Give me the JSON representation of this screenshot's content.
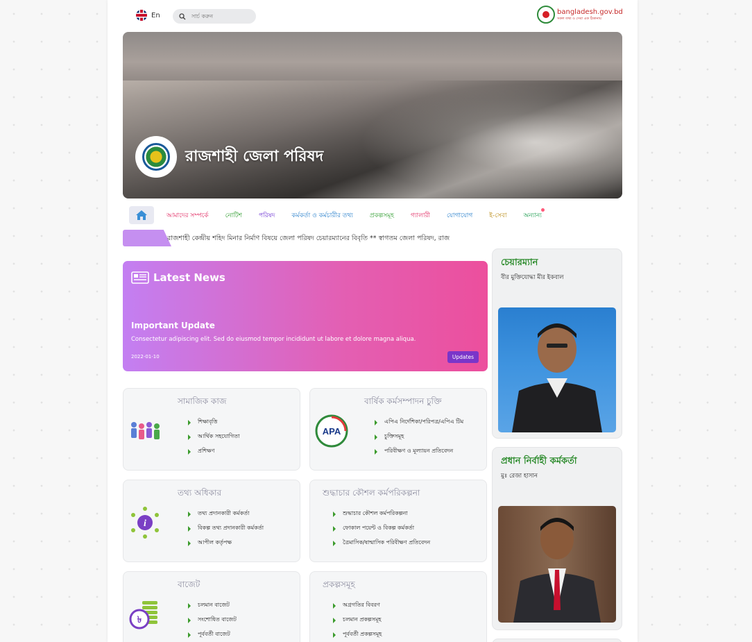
{
  "topbar": {
    "lang_label": "En",
    "search_placeholder": "সার্চ করুন",
    "gov_site": "bangladesh.gov.bd",
    "gov_tagline": "সকল তথ্য ও সেবা এক ঠিকানায়"
  },
  "brand": {
    "name": "রাজশাহী জেলা পরিষদ"
  },
  "nav": {
    "items": [
      {
        "label": "আমাদের সম্পর্কে",
        "color": "#e0245e"
      },
      {
        "label": "নোটিশ",
        "color": "#2e9c2e"
      },
      {
        "label": "পরিষদ",
        "color": "#6a2fd1"
      },
      {
        "label": "কর্মকর্তা ও কর্মচারীর তথ্য",
        "color": "#1f7ac9"
      },
      {
        "label": "প্রকল্পসমূহ",
        "color": "#2e9c2e"
      },
      {
        "label": "গ্যালারী",
        "color": "#e0245e"
      },
      {
        "label": "যোগাযোগ",
        "color": "#1f7ac9"
      },
      {
        "label": "ই-সেবা",
        "color": "#b98a12"
      },
      {
        "label": "অন্যান্য",
        "color": "#1b9c4e"
      }
    ]
  },
  "ticker": {
    "text": "রাজশাহী কেন্দ্রীয় শহিদ মিনার নির্মাণ বিষয়ে জেলা পরিষদ চেয়ারম্যানের বিবৃতি ** স্বাগতম জেলা পরিষদ, রাজ"
  },
  "latest": {
    "heading": "Latest News",
    "title": "Important Update",
    "desc": "Consectetur adipiscing elit. Sed do eiusmod tempor incididunt ut labore et dolore magna aliqua.",
    "date": "2022-01-10",
    "badge": "Updates"
  },
  "cards": [
    {
      "title": "সামাজিক কাজ",
      "links": [
        "শিক্ষাবৃত্তি",
        "আর্থিক সহযোগিতা",
        "প্রশিক্ষণ"
      ]
    },
    {
      "title": "বার্ষিক কর্মসম্পাদন চুক্তি",
      "links": [
        "এপিএ নির্দেশিকা/পরিপত্র/এপিএ টিম",
        "চুক্তিসমূহ",
        "পরিবীক্ষণ ও মূল্যায়ন প্রতিবেদন"
      ]
    },
    {
      "title": "তথ্য অধিকার",
      "links": [
        "তথ্য প্রদানকারী কর্মকর্তা",
        "বিকল্প তথ্য প্রদানকারী কর্মকর্তা",
        "আপীল কর্তৃপক্ষ"
      ]
    },
    {
      "title": "শুদ্ধাচার কৌশল কর্মপরিকল্পনা",
      "links": [
        "শুদ্ধাচার কৌশল কর্মপরিকল্পনা",
        "ফোকাল পয়েন্ট ও বিকল্প কর্মকর্তা",
        "ত্রৈমাসিক/ষান্মাসিক পরিবীক্ষণ প্রতিবেদন"
      ]
    },
    {
      "title": "বাজেট",
      "links": [
        "চলমান বাজেট",
        "সংশোধিত বাজেট",
        "পূর্ববর্তী বাজেট"
      ]
    },
    {
      "title": "প্রকল্পসমূহ",
      "links": [
        "অগ্রগতির বিবরণ",
        "চলমান প্রকল্পসমূহ",
        "পূর্ববর্তী প্রকল্পসমূহ"
      ]
    }
  ],
  "apa_icon_text": "APA",
  "side": [
    {
      "title": "চেয়ারম্যান",
      "name": "বীর মুক্তিযোদ্ধা মীর ইকবাল"
    },
    {
      "title": "প্রধান নির্বাহী কর্মকর্তা",
      "name": "মুঃ রেজা হাসান"
    }
  ]
}
